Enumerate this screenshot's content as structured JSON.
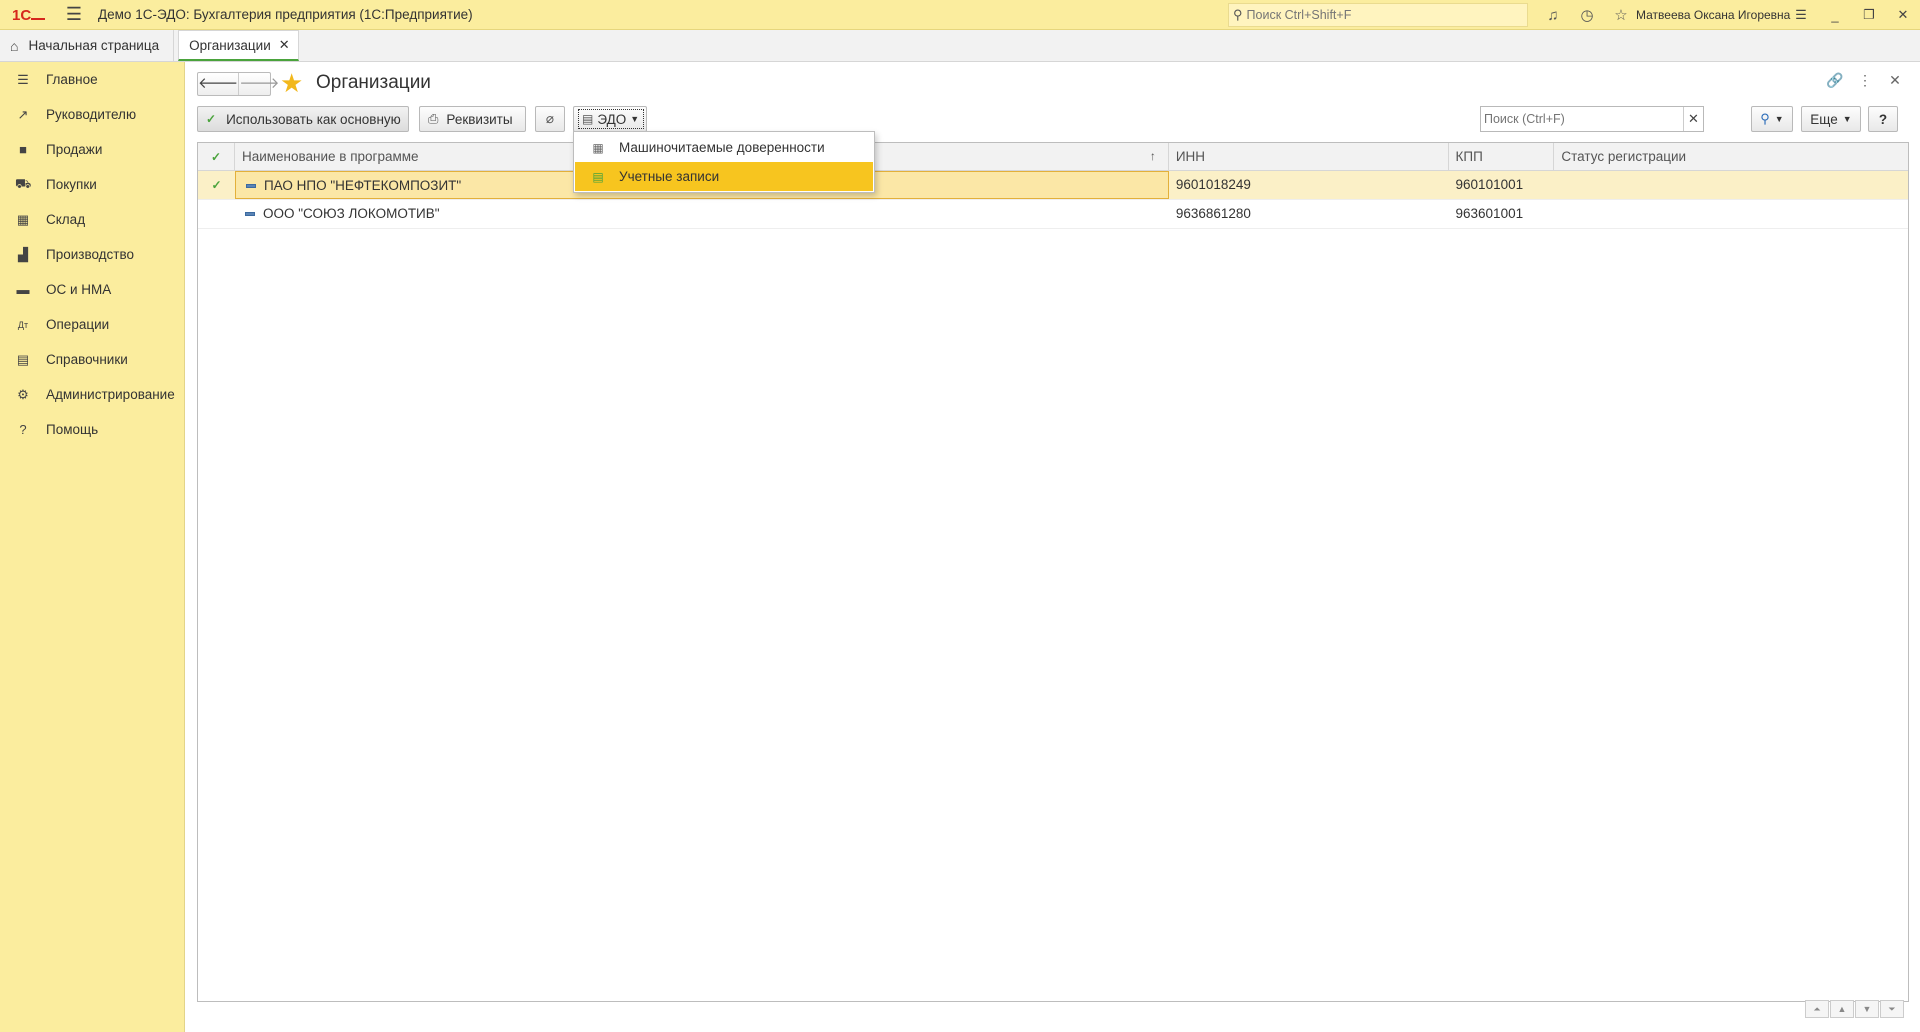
{
  "titlebar": {
    "logo": "1С",
    "app_title": "Демо 1С-ЭДО: Бухгалтерия предприятия  (1С:Предприятие)",
    "search_placeholder": "Поиск Ctrl+Shift+F",
    "user": "Матвеева Оксана Игоревна",
    "icons": [
      "bell-icon",
      "history-icon",
      "star-icon",
      "settings-menu-icon"
    ]
  },
  "tabs": {
    "home": "Начальная страница",
    "active": "Организации"
  },
  "sidebar": {
    "items": [
      {
        "label": "Главное",
        "icon": "menu-icon"
      },
      {
        "label": "Руководителю",
        "icon": "trend-icon"
      },
      {
        "label": "Продажи",
        "icon": "bag-icon"
      },
      {
        "label": "Покупки",
        "icon": "cart-icon"
      },
      {
        "label": "Склад",
        "icon": "warehouse-icon"
      },
      {
        "label": "Производство",
        "icon": "factory-icon"
      },
      {
        "label": "ОС и НМА",
        "icon": "truck-icon"
      },
      {
        "label": "Операции",
        "icon": "dt-kt-icon"
      },
      {
        "label": "Справочники",
        "icon": "books-icon"
      },
      {
        "label": "Администрирование",
        "icon": "gear-icon"
      },
      {
        "label": "Помощь",
        "icon": "help-icon"
      }
    ]
  },
  "form": {
    "title": "Организации",
    "toolbar": {
      "use_main": "Использовать как основную",
      "requisites": "Реквизиты",
      "edo": "ЭДО",
      "search_placeholder": "Поиск (Ctrl+F)",
      "more": "Еще",
      "help": "?"
    },
    "columns": [
      "Наименование в программе",
      "ИНН",
      "КПП",
      "Статус регистрации"
    ],
    "rows": [
      {
        "name": "ПАО НПО \"НЕФТЕКОМПОЗИТ\"",
        "inn": "9601018249",
        "kpp": "960101001",
        "status": "",
        "main": true
      },
      {
        "name": "ООО \"СОЮЗ ЛОКОМОТИВ\"",
        "inn": "9636861280",
        "kpp": "963601001",
        "status": "",
        "main": false
      }
    ]
  },
  "edo_menu": {
    "items": [
      "Машиночитаемые доверенности",
      "Учетные записи"
    ],
    "highlighted": 1
  },
  "colors": {
    "panel_yellow": "#fbed9e",
    "highlight": "#f7c51f",
    "accent_green": "#4aa33c"
  }
}
